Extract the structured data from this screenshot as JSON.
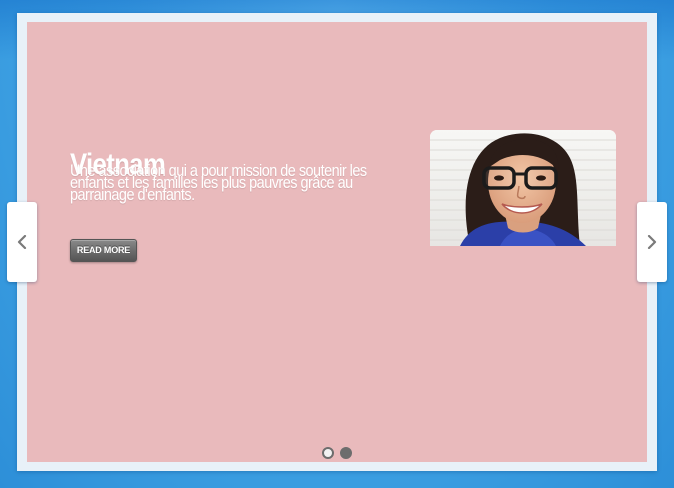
{
  "slider": {
    "slides": [
      {
        "title": "Vietnam",
        "description": "Une association qui a pour mission de soutenir les enfants et les familles les plus pauvres grâce au parrainage d'enfants.",
        "button_label": "READ MORE",
        "image": "portrait of smiling woman with glasses"
      }
    ],
    "active_slide": 1,
    "slide_count": 2,
    "colors": {
      "slide_background": "#e9babc",
      "frame": "#e8f1f8",
      "page_background": "#45a9e8",
      "button": "#6a6a6a",
      "dot_active_border": "#6d6d6d"
    },
    "nav": {
      "prev_icon": "chevron-left-icon",
      "next_icon": "chevron-right-icon"
    }
  }
}
